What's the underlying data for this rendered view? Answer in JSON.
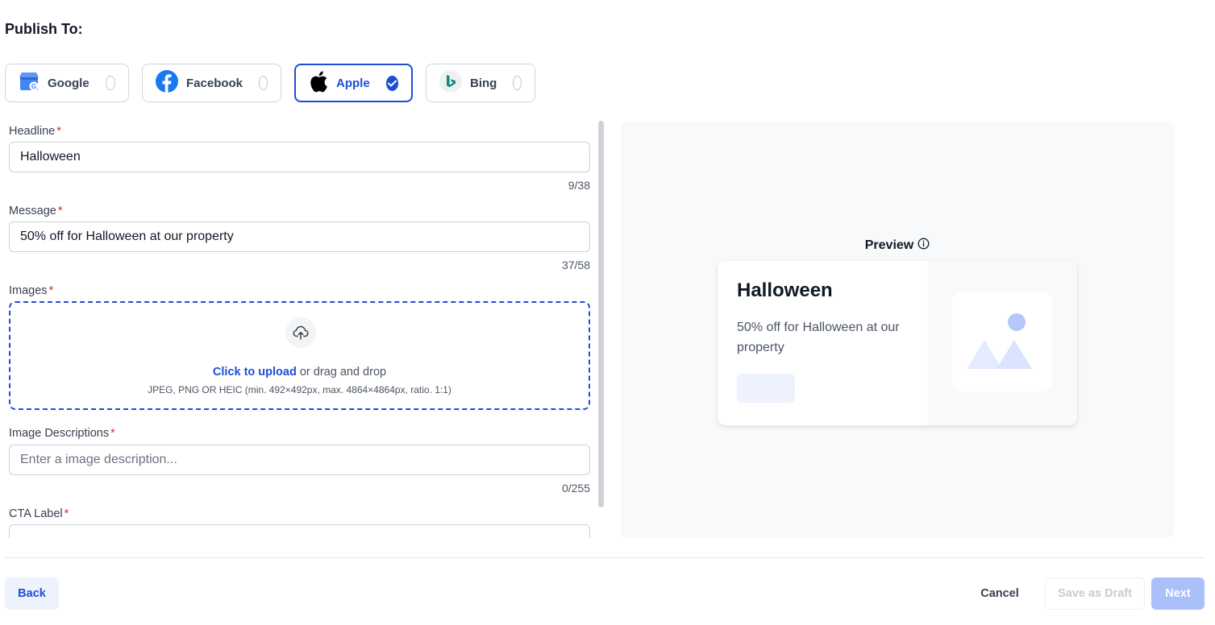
{
  "publish": {
    "title": "Publish To:"
  },
  "platforms": [
    {
      "name": "Google",
      "icon": "google-business-icon",
      "selected": false
    },
    {
      "name": "Facebook",
      "icon": "facebook-icon",
      "selected": false
    },
    {
      "name": "Apple",
      "icon": "apple-icon",
      "selected": true
    },
    {
      "name": "Bing",
      "icon": "bing-icon",
      "selected": false
    }
  ],
  "form": {
    "headline": {
      "label": "Headline",
      "required": "*",
      "value": "Halloween",
      "counter": "9/38"
    },
    "message": {
      "label": "Message",
      "required": "*",
      "value": "50% off for Halloween at our property",
      "counter": "37/58"
    },
    "images": {
      "label": "Images",
      "required": "*",
      "upload_link": "Click to upload",
      "upload_text": " or drag and drop",
      "hint": "JPEG, PNG OR HEIC (min. 492×492px, max. 4864×4864px, ratio. 1:1)"
    },
    "image_descriptions": {
      "label": "Image Descriptions",
      "required": "*",
      "placeholder": "Enter a image description...",
      "counter": "0/255"
    },
    "cta": {
      "label": "CTA Label",
      "required": "*"
    }
  },
  "preview": {
    "title": "Preview",
    "headline": "Halloween",
    "message": "50% off for Halloween at our property"
  },
  "footer": {
    "back": "Back",
    "cancel": "Cancel",
    "save_draft": "Save as Draft",
    "next": "Next"
  },
  "colors": {
    "accent": "#1d4ed8",
    "required": "#dc2626",
    "next_disabled": "#a9c0fb"
  }
}
